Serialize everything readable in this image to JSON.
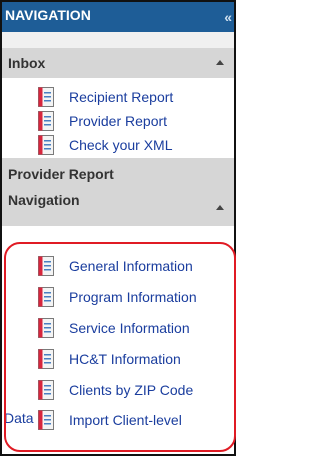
{
  "header": {
    "title": "NAVIGATION",
    "collapse": "«"
  },
  "inbox": {
    "title": "Inbox",
    "items": [
      {
        "label": "Recipient Report"
      },
      {
        "label": "Provider Report"
      },
      {
        "label": "Check your XML"
      }
    ]
  },
  "provider": {
    "title_line1": "Provider Report",
    "title_line2": "Navigation",
    "items": [
      {
        "label": "General Information"
      },
      {
        "label": "Program Information"
      },
      {
        "label": "Service Information"
      },
      {
        "label": "HC&T Information"
      },
      {
        "label": "Clients by ZIP Code"
      },
      {
        "label": "Import Client-level",
        "label_cont": "Data"
      }
    ]
  },
  "colors": {
    "header_bg": "#1e5d97",
    "section_bg": "#d6d6d6",
    "link": "#1a3d9e",
    "highlight": "#e01b24"
  }
}
